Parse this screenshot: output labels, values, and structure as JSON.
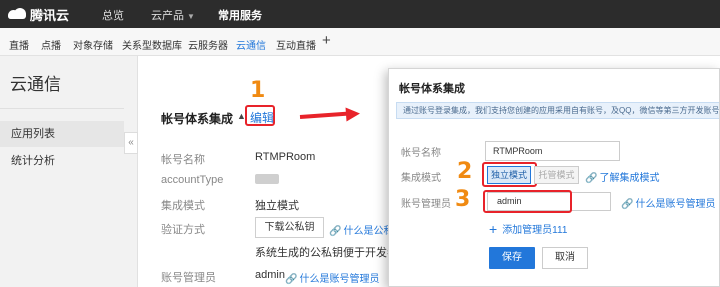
{
  "topbar": {
    "logo_text": "腾讯云",
    "nav": [
      "总览",
      "云产品",
      "常用服务"
    ]
  },
  "subnav": {
    "items": [
      "直播",
      "点播",
      "对象存储",
      "关系型数据库",
      "云服务器",
      "云通信",
      "互动直播"
    ],
    "active_index": 5,
    "plus": "+"
  },
  "sidebar": {
    "title": "云通信",
    "items": [
      "应用列表",
      "统计分析"
    ],
    "active_index": 0,
    "collapse_glyph": "«"
  },
  "main": {
    "section_title": "帐号体系集成",
    "edit_label": "编辑",
    "rows": {
      "account_name_label": "帐号名称",
      "account_name_value": "RTMPRoom",
      "account_type_label": "accountType",
      "integration_mode_label": "集成模式",
      "integration_mode_value": "独立模式",
      "verify_label": "验证方式",
      "download_key_label": "下载公私钥",
      "what_is_key": "什么是公私钥",
      "key_desc": "系统生成的公私钥便于开发者",
      "admin_label": "账号管理员",
      "admin_value": "admin",
      "what_is_admin": "什么是账号管理员"
    }
  },
  "annotations": {
    "n1": "1",
    "n2": "2",
    "n3": "3"
  },
  "modal": {
    "title": "帐号体系集成",
    "notice": "通过账号登录集成，我们支持您创建的应用采用自有账号，及QQ，微信等第三方开发账号",
    "account_name_label": "帐号名称",
    "account_name_value": "RTMPRoom",
    "mode_label": "集成模式",
    "mode_option1": "独立模式",
    "mode_option2": "托管模式",
    "learn_mode": "了解集成模式",
    "admin_label": "账号管理员",
    "admin_value": "admin",
    "what_is_admin": "什么是账号管理员",
    "add_admin": "添加管理员111",
    "save_label": "保存",
    "cancel_label": "取消"
  },
  "colors": {
    "accent": "#2277da",
    "annotation_red": "#e8232a",
    "annotation_orange": "#f08a12"
  }
}
